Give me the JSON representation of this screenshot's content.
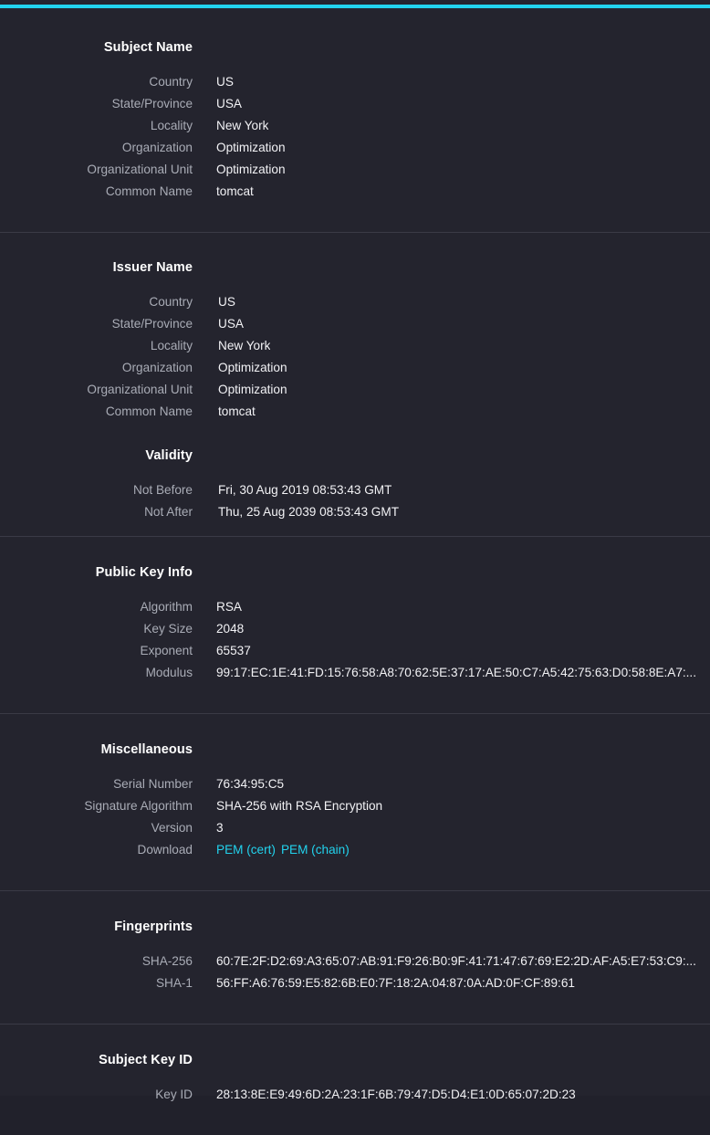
{
  "theme": {
    "background": "#24242e",
    "accent": "#22d3ee",
    "label_color": "#a9acb6",
    "value_color": "#f2f2f5",
    "divider": "#3a3a46"
  },
  "sections": {
    "subject_name": {
      "heading": "Subject Name",
      "rows": [
        {
          "label": "Country",
          "value": "US"
        },
        {
          "label": "State/Province",
          "value": "USA"
        },
        {
          "label": "Locality",
          "value": "New York"
        },
        {
          "label": "Organization",
          "value": "Optimization"
        },
        {
          "label": "Organizational Unit",
          "value": "Optimization"
        },
        {
          "label": "Common Name",
          "value": "tomcat"
        }
      ]
    },
    "issuer_name": {
      "heading": "Issuer Name",
      "rows": [
        {
          "label": "Country",
          "value": "US"
        },
        {
          "label": "State/Province",
          "value": "USA"
        },
        {
          "label": "Locality",
          "value": "New York"
        },
        {
          "label": "Organization",
          "value": "Optimization"
        },
        {
          "label": "Organizational Unit",
          "value": "Optimization"
        },
        {
          "label": "Common Name",
          "value": "tomcat"
        }
      ]
    },
    "validity": {
      "heading": "Validity",
      "rows": [
        {
          "label": "Not Before",
          "value": "Fri, 30 Aug 2019 08:53:43 GMT"
        },
        {
          "label": "Not After",
          "value": "Thu, 25 Aug 2039 08:53:43 GMT"
        }
      ]
    },
    "public_key_info": {
      "heading": "Public Key Info",
      "rows": [
        {
          "label": "Algorithm",
          "value": "RSA"
        },
        {
          "label": "Key Size",
          "value": "2048"
        },
        {
          "label": "Exponent",
          "value": "65537"
        },
        {
          "label": "Modulus",
          "value": "99:17:EC:1E:41:FD:15:76:58:A8:70:62:5E:37:17:AE:50:C7:A5:42:75:63:D0:58:8E:A7:..."
        }
      ]
    },
    "miscellaneous": {
      "heading": "Miscellaneous",
      "rows": [
        {
          "label": "Serial Number",
          "value": "76:34:95:C5"
        },
        {
          "label": "Signature Algorithm",
          "value": "SHA-256 with RSA Encryption"
        },
        {
          "label": "Version",
          "value": "3"
        }
      ],
      "download": {
        "label": "Download",
        "links": [
          {
            "text": "PEM (cert)"
          },
          {
            "text": "PEM (chain)"
          }
        ]
      }
    },
    "fingerprints": {
      "heading": "Fingerprints",
      "rows": [
        {
          "label": "SHA-256",
          "value": "60:7E:2F:D2:69:A3:65:07:AB:91:F9:26:B0:9F:41:71:47:67:69:E2:2D:AF:A5:E7:53:C9:..."
        },
        {
          "label": "SHA-1",
          "value": "56:FF:A6:76:59:E5:82:6B:E0:7F:18:2A:04:87:0A:AD:0F:CF:89:61"
        }
      ]
    },
    "subject_key_id": {
      "heading": "Subject Key ID",
      "rows": [
        {
          "label": "Key ID",
          "value": "28:13:8E:E9:49:6D:2A:23:1F:6B:79:47:D5:D4:E1:0D:65:07:2D:23"
        }
      ]
    }
  }
}
